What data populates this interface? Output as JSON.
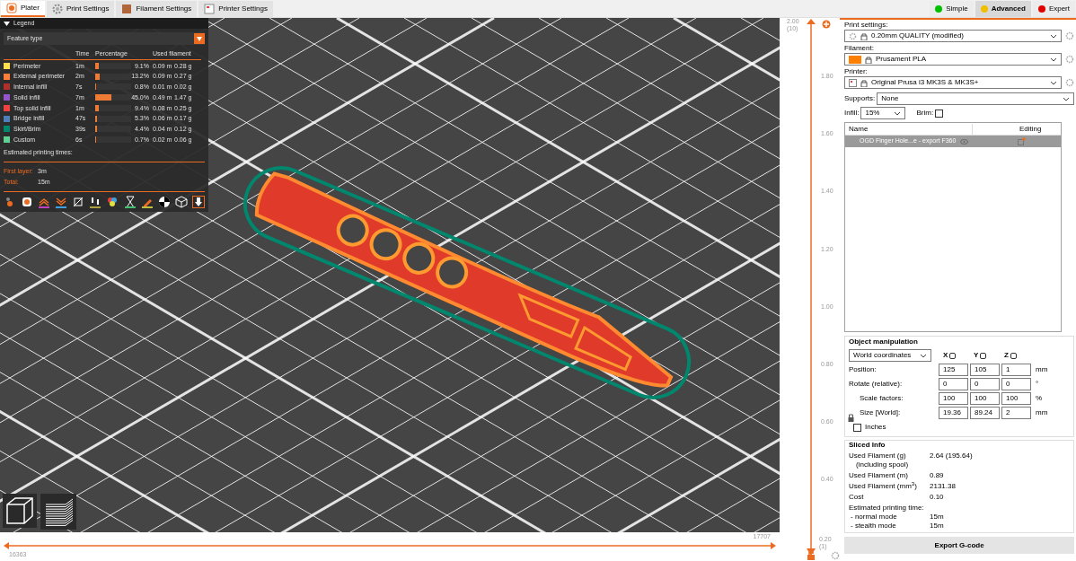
{
  "top_tabs": [
    {
      "label": "Plater",
      "selected": true,
      "kind": "plater"
    },
    {
      "label": "Print Settings",
      "selected": false,
      "kind": "gear"
    },
    {
      "label": "Filament Settings",
      "selected": false,
      "kind": "spool"
    },
    {
      "label": "Printer Settings",
      "selected": false,
      "kind": "printer"
    }
  ],
  "modes": [
    {
      "label": "Simple",
      "color": "#00c000",
      "selected": false
    },
    {
      "label": "Advanced",
      "color": "#f0c000",
      "selected": true
    },
    {
      "label": "Expert",
      "color": "#e00000",
      "selected": false
    }
  ],
  "legend": {
    "title": "Legend",
    "expanded": true,
    "view_type": "Feature type",
    "columns": [
      "Time",
      "Percentage",
      "Used filament"
    ],
    "rows": [
      {
        "name": "Perimeter",
        "color": "#ffe04a",
        "time": "1m",
        "level": 0.091,
        "percentage": "9.1%",
        "length": "0.09 m",
        "weight": "0.28 g"
      },
      {
        "name": "External perimeter",
        "color": "#ff7d38",
        "time": "2m",
        "level": 0.132,
        "percentage": "13.2%",
        "length": "0.09 m",
        "weight": "0.27 g"
      },
      {
        "name": "Internal infill",
        "color": "#b03029",
        "time": "7s",
        "level": 0.008,
        "percentage": "0.8%",
        "length": "0.01 m",
        "weight": "0.02 g"
      },
      {
        "name": "Solid infill",
        "color": "#9654cc",
        "time": "7m",
        "level": 0.45,
        "percentage": "45.0%",
        "length": "0.49 m",
        "weight": "1.47 g"
      },
      {
        "name": "Top solid infill",
        "color": "#f04040",
        "time": "1m",
        "level": 0.094,
        "percentage": "9.4%",
        "length": "0.08 m",
        "weight": "0.25 g"
      },
      {
        "name": "Bridge infill",
        "color": "#4d80ba",
        "time": "47s",
        "level": 0.053,
        "percentage": "5.3%",
        "length": "0.06 m",
        "weight": "0.17 g"
      },
      {
        "name": "Skirt/Brim",
        "color": "#00876e",
        "time": "39s",
        "level": 0.044,
        "percentage": "4.4%",
        "length": "0.04 m",
        "weight": "0.12 g"
      },
      {
        "name": "Custom",
        "color": "#5ed194",
        "time": "6s",
        "level": 0.007,
        "percentage": "0.7%",
        "length": "0.02 m",
        "weight": "0.06 g"
      }
    ],
    "estimated_title": "Estimated printing times:",
    "times": [
      {
        "label": "First layer:",
        "value": "3m"
      },
      {
        "label": "Total:",
        "value": "15m"
      }
    ]
  },
  "vertical_slider": {
    "top_value": "2.00",
    "top_layer": "(10)",
    "ticks": [
      "1.80",
      "1.60",
      "1.40",
      "1.20",
      "1.00",
      "0.80",
      "0.60",
      "0.40"
    ],
    "bottom_value": "0.20",
    "bottom_layer": "(1)"
  },
  "horizontal_slider": {
    "left_value": "16363",
    "right_value": "17707"
  },
  "sidebar": {
    "print_settings": {
      "label": "Print settings:",
      "value": "0.20mm QUALITY (modified)"
    },
    "filament": {
      "label": "Filament:",
      "value": "Prusament PLA",
      "color": "#ff8000"
    },
    "printer": {
      "label": "Printer:",
      "value": "Original Prusa i3 MK3S & MK3S+"
    },
    "supports": {
      "label": "Supports:",
      "value": "None"
    },
    "infill": {
      "label": "Infill:",
      "value": "15%"
    },
    "brim": {
      "label": "Brim:",
      "checked": false
    },
    "object_list": {
      "columns": [
        "Name",
        "Editing"
      ],
      "rows": [
        {
          "name": "OGD Finger Hole...e - export F360",
          "selected": true
        }
      ]
    },
    "object_manipulation": {
      "title": "Object manipulation",
      "coordinates": "World coordinates",
      "axes": [
        "X",
        "Y",
        "Z"
      ],
      "rows": [
        {
          "label": "Position:",
          "values": [
            "125",
            "105",
            "1"
          ],
          "unit": "mm"
        },
        {
          "label": "Rotate (relative):",
          "values": [
            "0",
            "0",
            "0"
          ],
          "unit": "°"
        },
        {
          "label": "Scale factors:",
          "values": [
            "100",
            "100",
            "100"
          ],
          "unit": "%"
        },
        {
          "label": "Size [World]:",
          "values": [
            "19.36",
            "89.24",
            "2"
          ],
          "unit": "mm"
        }
      ],
      "inches": {
        "label": "Inches",
        "checked": false
      }
    },
    "sliced_info": {
      "title": "Sliced Info",
      "rows": [
        {
          "label": "Used Filament (g)",
          "sub": "(including spool)",
          "value": "2.64 (195.64)"
        },
        {
          "label": "Used Filament (m)",
          "value": "0.89"
        },
        {
          "label": "Used Filament (mm$^{3}$)",
          "value": "2131.38"
        },
        {
          "label": "Cost",
          "value": "0.10"
        }
      ],
      "time_title": "Estimated printing time:",
      "modes": [
        {
          "label": "- normal mode",
          "value": "15m"
        },
        {
          "label": "- stealth mode",
          "value": "15m"
        }
      ]
    },
    "export_button": "Export G-code"
  }
}
